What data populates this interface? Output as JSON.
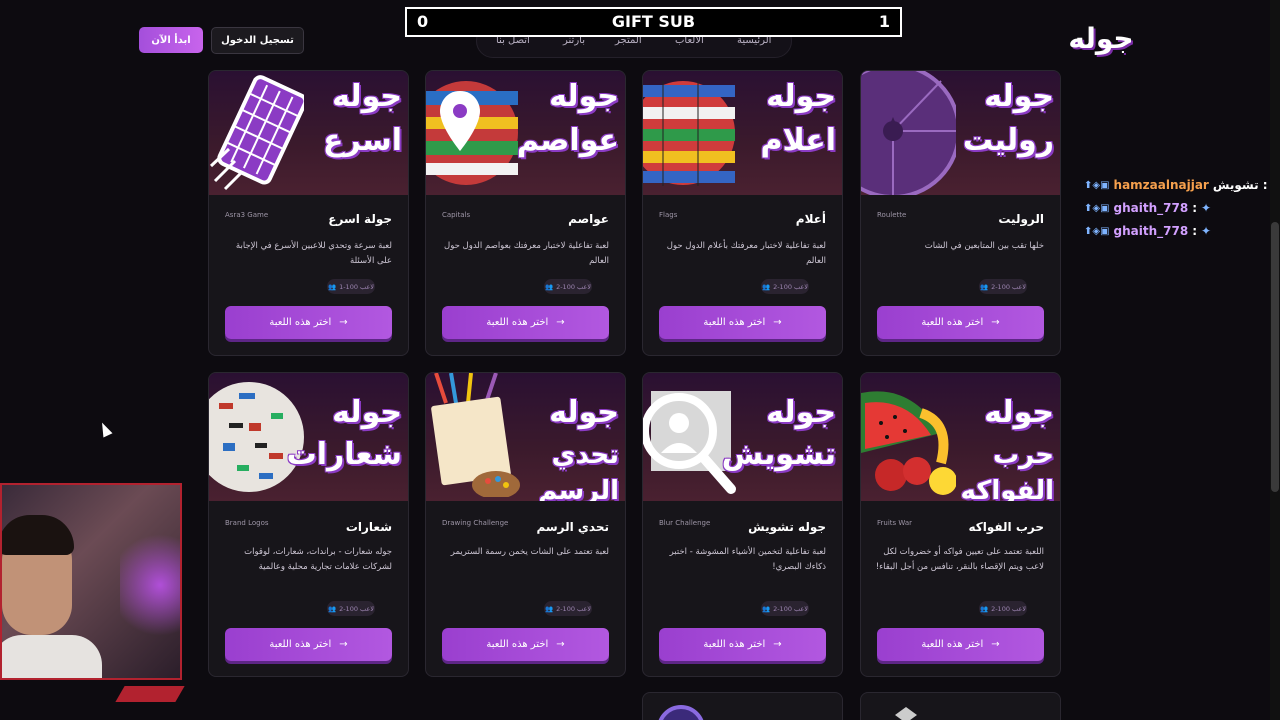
{
  "nav": {
    "items": [
      "الرئيسية",
      "الألعاب",
      "المتجر",
      "بارتنر",
      "اتصل بنا"
    ],
    "login_label": "تسجيل الدخول",
    "start_label": "ابدأ الآن",
    "logo_text": "جوله"
  },
  "gift_bar": {
    "left_value": "0",
    "title": "GIFT SUB",
    "right_value": "1"
  },
  "cards": [
    {
      "banner_l1": "جوله",
      "banner_l2": "اسرع",
      "name": "جولة اسرع",
      "sub": "Asra3 Game",
      "desc": "لعبة سرعة وتحدي للاعبين الأسرع في الإجابة على الأسئلة",
      "players": "1-100 لاعب",
      "button": "اختر هذه اللعبة",
      "art_icon": "keyboard-icon"
    },
    {
      "banner_l1": "جوله",
      "banner_l2": "عواصم",
      "name": "عواصم",
      "sub": "Capitals",
      "desc": "لعبة تفاعلية لاختبار معرفتك بعواصم الدول حول العالم",
      "players": "2-100 لاعب",
      "button": "اختر هذه اللعبة",
      "art_icon": "globe-pin-icon"
    },
    {
      "banner_l1": "جوله",
      "banner_l2": "اعلام",
      "name": "أعلام",
      "sub": "Flags",
      "desc": "لعبة تفاعلية لاختبار معرفتك بأعلام الدول حول العالم",
      "players": "2-100 لاعب",
      "button": "اختر هذه اللعبة",
      "art_icon": "flags-globe-icon"
    },
    {
      "banner_l1": "جوله",
      "banner_l2": "روليت",
      "name": "الروليت",
      "sub": "Roulette",
      "desc": "خلها تقب بين المتابعين في الشات",
      "players": "2-100 لاعب",
      "button": "اختر هذه اللعبة",
      "art_icon": "roulette-wheel-icon"
    },
    {
      "banner_l1": "جوله",
      "banner_l2": "شعارات",
      "name": "شعارات",
      "sub": "Brand Logos",
      "desc": "جوله شعارات - براندات، شعارات، لوقوات لشركات علامات تجارية محلية وعالمية",
      "players": "2-100 لاعب",
      "button": "اختر هذه اللعبة",
      "art_icon": "logos-globe-icon"
    },
    {
      "banner_l1": "جوله",
      "banner_l2": "تحدي الرسم",
      "name": "تحدي الرسم",
      "sub": "Drawing Challenge",
      "desc": "لعبة تعتمد على الشات يخمن رسمة الستريمر",
      "players": "2-100 لاعب",
      "button": "اختر هذه اللعبة",
      "art_icon": "paint-palette-icon"
    },
    {
      "banner_l1": "جوله",
      "banner_l2": "تشويش",
      "name": "جوله تشويش",
      "sub": "Blur Challenge",
      "desc": "لعبة تفاعلية لتخمين الأشياء المشوشة - اختبر ذكاءك البصري!",
      "players": "2-100 لاعب",
      "button": "اختر هذه اللعبة",
      "art_icon": "magnifier-icon"
    },
    {
      "banner_l1": "جوله",
      "banner_l2": "حرب الفواكه",
      "name": "حرب الفواكه",
      "sub": "Fruits War",
      "desc": "اللعبة تعتمد على تعيين فواكه أو خضروات لكل لاعب ويتم الإقصاء بالنقر، تنافس من أجل البقاء!",
      "players": "2-100 لاعب",
      "button": "اختر هذه اللعبة",
      "art_icon": "fruits-icon"
    }
  ],
  "chat": {
    "label": "تشويش :",
    "messages": [
      {
        "user": "hamzaalnajjar",
        "badges": "⬆◈▣",
        "emote": ""
      },
      {
        "user": "ghaith_778",
        "badges": "⬆◈▣",
        "emote": "✦"
      },
      {
        "user": "ghaith_778",
        "badges": "⬆◈▣",
        "emote": "✦"
      }
    ]
  },
  "colors": {
    "accent": "#a44fdb",
    "background": "#0d0b10",
    "card": "#17151a"
  }
}
